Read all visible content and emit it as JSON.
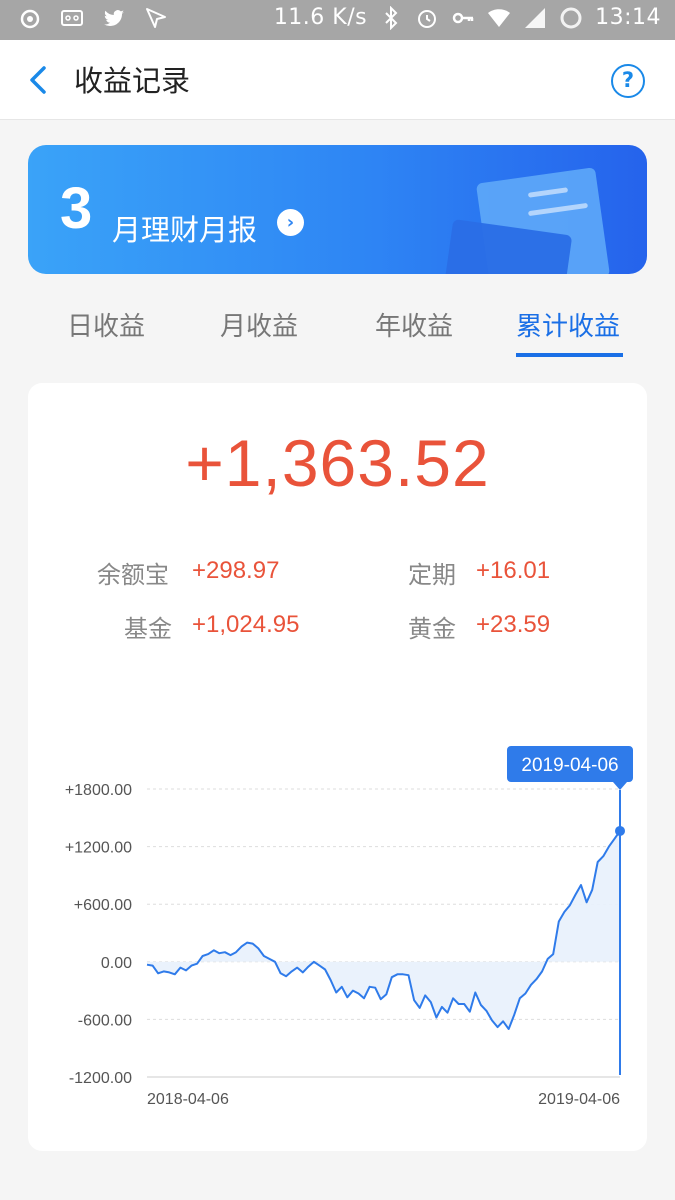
{
  "status_bar": {
    "network_speed": "11.6 K/s",
    "time": "13:14",
    "icons": [
      "weibo-icon",
      "voicemail-icon",
      "twitter-icon",
      "send-icon",
      "bluetooth-icon",
      "alarm-icon",
      "key-icon",
      "wifi-icon",
      "signal-icon",
      "battery-icon"
    ]
  },
  "header": {
    "title": "收益记录",
    "help_label": "?"
  },
  "banner": {
    "month": "3",
    "text": "月理财月报",
    "arrow": "›"
  },
  "tabs": [
    {
      "label": "日收益",
      "active": false
    },
    {
      "label": "月收益",
      "active": false
    },
    {
      "label": "年收益",
      "active": false
    },
    {
      "label": "累计收益",
      "active": true
    }
  ],
  "summary": {
    "total": "+1,363.52",
    "items": [
      {
        "label": "余额宝",
        "value": "+298.97"
      },
      {
        "label": "定期",
        "value": "+16.01"
      },
      {
        "label": "基金",
        "value": "+1,024.95"
      },
      {
        "label": "黄金",
        "value": "+23.59"
      }
    ]
  },
  "chart_data": {
    "type": "area",
    "ylim": [
      -1200,
      1800
    ],
    "yticks": [
      "+1800.00",
      "+1200.00",
      "+600.00",
      "0.00",
      "-600.00",
      "-1200.00"
    ],
    "x_start_label": "2018-04-06",
    "x_end_label": "2019-04-06",
    "tooltip_label": "2019-04-06",
    "colors": {
      "line": "#2f7bea",
      "fill": "#e8f1fc",
      "grid": "#dddddd"
    },
    "series": [
      {
        "values": [
          -30,
          -40,
          -120,
          -100,
          -110,
          -130,
          -60,
          -90,
          -40,
          -20,
          60,
          80,
          120,
          90,
          100,
          70,
          100,
          160,
          200,
          190,
          140,
          60,
          30,
          0,
          -120,
          -150,
          -100,
          -60,
          -110,
          -50,
          0,
          -40,
          -80,
          -190,
          -320,
          -260,
          -370,
          -300,
          -330,
          -380,
          -260,
          -270,
          -390,
          -340,
          -160,
          -130,
          -130,
          -140,
          -400,
          -480,
          -350,
          -420,
          -580,
          -470,
          -530,
          -380,
          -440,
          -440,
          -520,
          -320,
          -450,
          -510,
          -610,
          -680,
          -620,
          -700,
          -550,
          -380,
          -330,
          -240,
          -180,
          -100,
          30,
          80,
          420,
          520,
          590,
          700,
          800,
          620,
          750,
          1040,
          1100,
          1200,
          1280,
          1363
        ]
      }
    ]
  }
}
